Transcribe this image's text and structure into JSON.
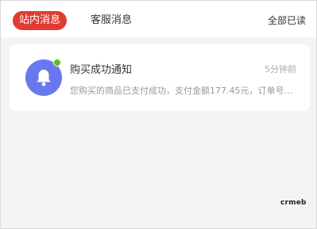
{
  "tabs": [
    {
      "label": "站内消息",
      "active": true
    },
    {
      "label": "客服消息",
      "active": false
    }
  ],
  "mark_all_read": "全部已读",
  "messages": [
    {
      "icon": "bell-icon",
      "unread": true,
      "title": "购买成功通知",
      "time": "5分钟前",
      "preview": "您购买的商品已支付成功，支付金额177.45元，订单号：..."
    }
  ],
  "watermark": "crmeb",
  "colors": {
    "accent": "#e03c33",
    "avatar_bg": "#6a78ef",
    "unread_dot": "#52c41a"
  }
}
